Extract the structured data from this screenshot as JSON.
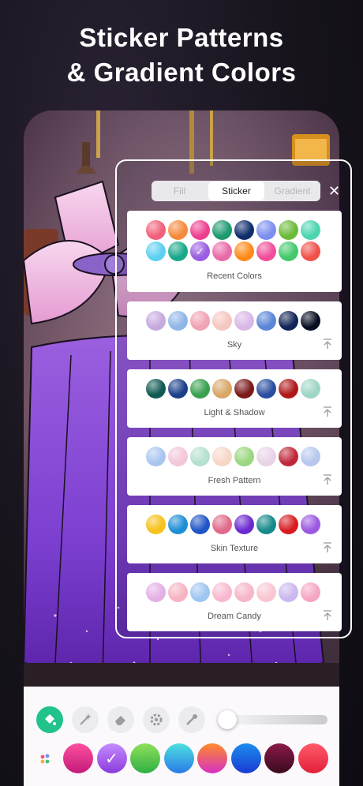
{
  "headline": {
    "line1": "Sticker Patterns",
    "line2": "& Gradient Colors"
  },
  "panel": {
    "tabs": [
      {
        "label": "Fill",
        "selected": false
      },
      {
        "label": "Sticker",
        "selected": true
      },
      {
        "label": "Gradient",
        "selected": false
      }
    ],
    "close_icon": "close-icon",
    "sections": [
      {
        "name": "Recent Colors",
        "pin": false,
        "rows": [
          [
            "#f0607a",
            "#f58a3c",
            "#ee3f8f",
            "#1d9a6f",
            "#0f2d6b",
            "#7b8ff0",
            "#6cba3a",
            "#4bd5b0"
          ],
          [
            "#5cd0f0",
            "#1aa88a",
            "#9b5de0",
            "#e86aa8",
            "#ff8a1a",
            "#f04e9a",
            "#43c86a",
            "#f0524a"
          ]
        ],
        "checked_index": 10
      },
      {
        "name": "Sky",
        "pin": true,
        "rows": [
          [
            "#c7a9df",
            "#8fb6e8",
            "#f0a3b3",
            "#f6c6c0",
            "#d9b8e6",
            "#5a86d8",
            "#122456",
            "#080e22"
          ]
        ]
      },
      {
        "name": "Light & Shadow",
        "pin": true,
        "rows": [
          [
            "#0f5a52",
            "#1c3f8a",
            "#3aa050",
            "#d8a766",
            "#7a1a1a",
            "#2a4ea0",
            "#b01818",
            "#9fd5c6"
          ]
        ]
      },
      {
        "name": "Fresh Pattern",
        "pin": true,
        "rows": [
          [
            "#a9c6f0",
            "#f3c7da",
            "#b6e0cf",
            "#f7d6c8",
            "#9bd680",
            "#e9d3e7",
            "#c0283a",
            "#b7c7ee"
          ]
        ]
      },
      {
        "name": "Skin Texture",
        "pin": true,
        "rows": [
          [
            "#f7c21a",
            "#1e8fd5",
            "#1f55c6",
            "#e06a8a",
            "#6b2ad0",
            "#178a8a",
            "#d81c22",
            "#9b58e0"
          ]
        ]
      },
      {
        "name": "Dream Candy",
        "pin": true,
        "rows": [
          [
            "#e3b0e6",
            "#f7b3c3",
            "#9fc6f0",
            "#f8b9cf",
            "#f6b6c7",
            "#f8c6d1",
            "#cbb8ee",
            "#f5a6c4"
          ]
        ]
      }
    ]
  },
  "toolbar": {
    "tools": [
      {
        "name": "fill-bucket-icon",
        "active": true
      },
      {
        "name": "magic-wand-icon",
        "active": false
      },
      {
        "name": "eraser-icon",
        "active": false
      },
      {
        "name": "gear-icon",
        "active": false
      },
      {
        "name": "eyedropper-icon",
        "active": false
      }
    ],
    "slider_value": 0.0,
    "palette_icon": "palette-icon",
    "swatches": [
      {
        "from": "#ff4fa0",
        "to": "#c21a7a",
        "checked": false
      },
      {
        "from": "#c58bff",
        "to": "#8a3bdc",
        "checked": true
      },
      {
        "from": "#8ee05a",
        "to": "#2fae44",
        "checked": false
      },
      {
        "from": "#4de0e0",
        "to": "#2a7ae8",
        "checked": false
      },
      {
        "from": "#ff8a2a",
        "to": "#d630c4",
        "checked": false
      },
      {
        "from": "#1c8df0",
        "to": "#1a3ad0",
        "checked": false
      },
      {
        "from": "#8a1a4a",
        "to": "#3a0a1e",
        "checked": false
      },
      {
        "from": "#ff5a6a",
        "to": "#e2203a",
        "checked": false
      }
    ]
  }
}
